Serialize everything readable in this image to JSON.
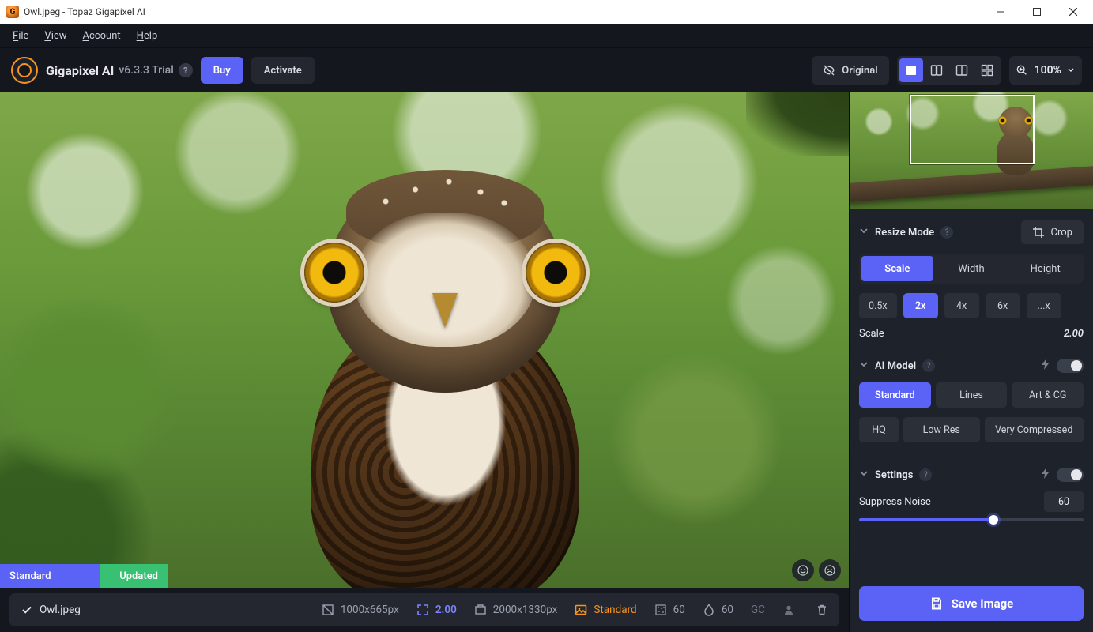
{
  "window": {
    "title": "Owl.jpeg - Topaz Gigapixel AI",
    "app_icon_letter": "G"
  },
  "menubar": {
    "items": [
      "File",
      "View",
      "Account",
      "Help"
    ]
  },
  "toolbar": {
    "brand": "Gigapixel AI",
    "version": "v6.3.3 Trial",
    "buy": "Buy",
    "activate": "Activate",
    "original": "Original",
    "zoom": "100%"
  },
  "viewport": {
    "status_left": "Standard",
    "status_right": "Updated"
  },
  "filebar": {
    "filename": "Owl.jpeg",
    "src_dim": "1000x665px",
    "scale": "2.00",
    "out_dim": "2000x1330px",
    "model": "Standard",
    "noise": "60",
    "blur": "60",
    "gc": "GC"
  },
  "panel": {
    "resize": {
      "title": "Resize Mode",
      "crop": "Crop",
      "tabs": [
        "Scale",
        "Width",
        "Height"
      ],
      "scales": [
        "0.5x",
        "2x",
        "4x",
        "6x",
        "...x"
      ],
      "scale_label": "Scale",
      "scale_value": "2.00"
    },
    "aimodel": {
      "title": "AI Model",
      "row1": [
        "Standard",
        "Lines",
        "Art & CG"
      ],
      "row2": [
        "HQ",
        "Low Res",
        "Very Compressed"
      ]
    },
    "settings": {
      "title": "Settings",
      "suppress": "Suppress Noise",
      "suppress_val": "60"
    },
    "save": "Save Image"
  }
}
